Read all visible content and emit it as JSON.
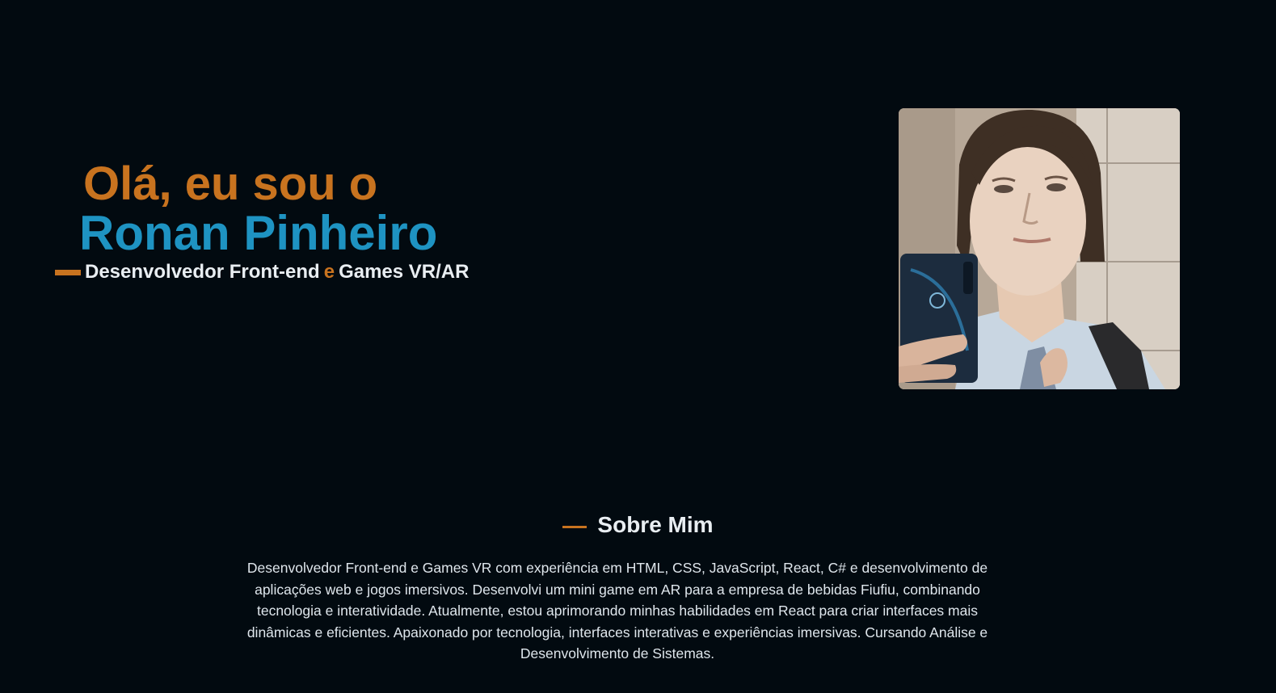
{
  "hero": {
    "greeting": "Olá, eu sou o",
    "name": "Ronan Pinheiro",
    "role_part1": "Desenvolvedor Front-end",
    "role_connector": "e",
    "role_part2": "Games VR/AR",
    "photo_alt": "Ronan Pinheiro"
  },
  "about": {
    "title": "Sobre Mim",
    "text": "Desenvolvedor Front-end e Games VR com experiência em HTML, CSS, JavaScript, React, C# e desenvolvimento de aplicações web e jogos imersivos. Desenvolvi um mini game em AR para a empresa de bebidas Fiufiu, combinando tecnologia e interatividade. Atualmente, estou aprimorando minhas habilidades em React para criar interfaces mais dinâmicas e eficientes. Apaixonado por tecnologia, interfaces interativas e experiências imersivas. Cursando Análise e Desenvolvimento de Sistemas."
  },
  "colors": {
    "background": "#020a10",
    "accent_orange": "#c8731f",
    "accent_blue": "#1e93c2",
    "text_light": "#e9eef2"
  }
}
